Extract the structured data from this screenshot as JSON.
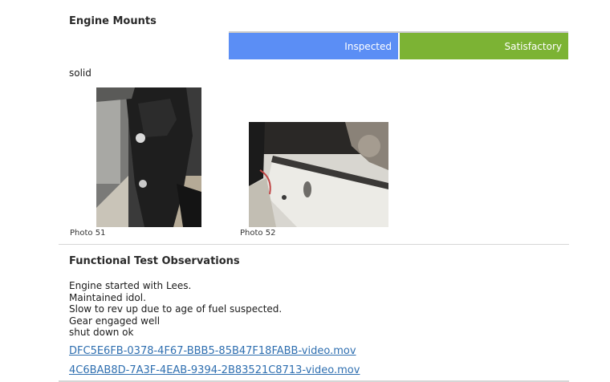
{
  "mounts_section": {
    "title": "Engine Mounts",
    "status_primary": "Inspected",
    "status_secondary": "Satisfactory",
    "colors": {
      "inspected": "#5b8ef5",
      "satisfactory": "#7cb334"
    },
    "note": "solid",
    "photos": [
      {
        "caption": "Photo 51",
        "icon": "engine-mount-photo"
      },
      {
        "caption": "Photo 52",
        "icon": "engine-mount-closeup-photo"
      }
    ]
  },
  "functional_section": {
    "title": "Functional Test Observations",
    "lines": [
      "Engine started with Lees.",
      "Maintained idol.",
      "Slow to rev  up due to age of fuel suspected.",
      "Gear engaged well",
      "shut down ok"
    ],
    "videos": [
      "DFC5E6FB-0378-4F67-BBB5-85B47F18FABB-video.mov",
      "4C6BAB8D-7A3F-4EAB-9394-2B83521C8713-video.mov"
    ]
  }
}
